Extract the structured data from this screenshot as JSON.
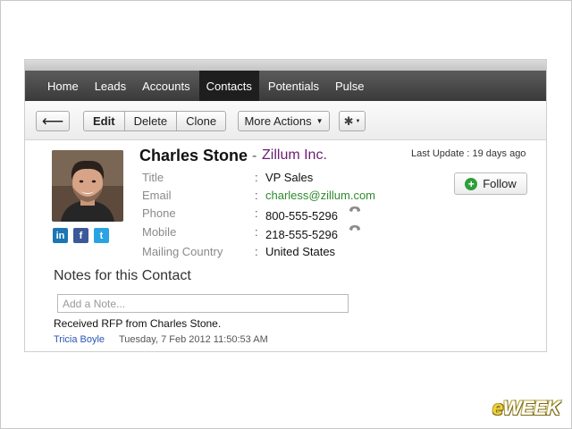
{
  "nav": {
    "items": [
      {
        "label": "Home",
        "active": false
      },
      {
        "label": "Leads",
        "active": false
      },
      {
        "label": "Accounts",
        "active": false
      },
      {
        "label": "Contacts",
        "active": true
      },
      {
        "label": "Potentials",
        "active": false
      },
      {
        "label": "Pulse",
        "active": false
      }
    ]
  },
  "toolbar": {
    "back_label": "⟵",
    "edit_label": "Edit",
    "delete_label": "Delete",
    "clone_label": "Clone",
    "more_actions_label": "More Actions",
    "gear_label": "✱"
  },
  "contact": {
    "name": "Charles Stone",
    "separator": "-",
    "company": "Zillum Inc.",
    "last_update": "Last Update : 19 days ago",
    "follow_label": "Follow",
    "fields": [
      {
        "label": "Title",
        "value": "VP Sales"
      },
      {
        "label": "Email",
        "value": "charless@zillum.com"
      },
      {
        "label": "Phone",
        "value": "800-555-5296"
      },
      {
        "label": "Mobile",
        "value": "218-555-5296"
      },
      {
        "label": "Mailing Country",
        "value": "United States"
      }
    ],
    "field_colon": ":"
  },
  "social": {
    "linkedin": "in",
    "facebook": "f",
    "twitter": "t"
  },
  "notes": {
    "title": "Notes for this Contact",
    "input_placeholder": "Add a Note...",
    "entries": [
      {
        "text": "Received RFP from Charles Stone.",
        "author": "Tricia Boyle",
        "date": "Tuesday, 7 Feb 2012 11:50:53 AM"
      }
    ]
  },
  "watermark": {
    "prefix": "e",
    "rest": "WEEK"
  },
  "colors": {
    "company": "#6a1e6f",
    "email": "#2e8b2e",
    "author_link": "#2a56b3",
    "follow_plus": "#2e9e3a",
    "nav_bg": "#3a3a3a",
    "nav_active": "#1e1e1e"
  }
}
